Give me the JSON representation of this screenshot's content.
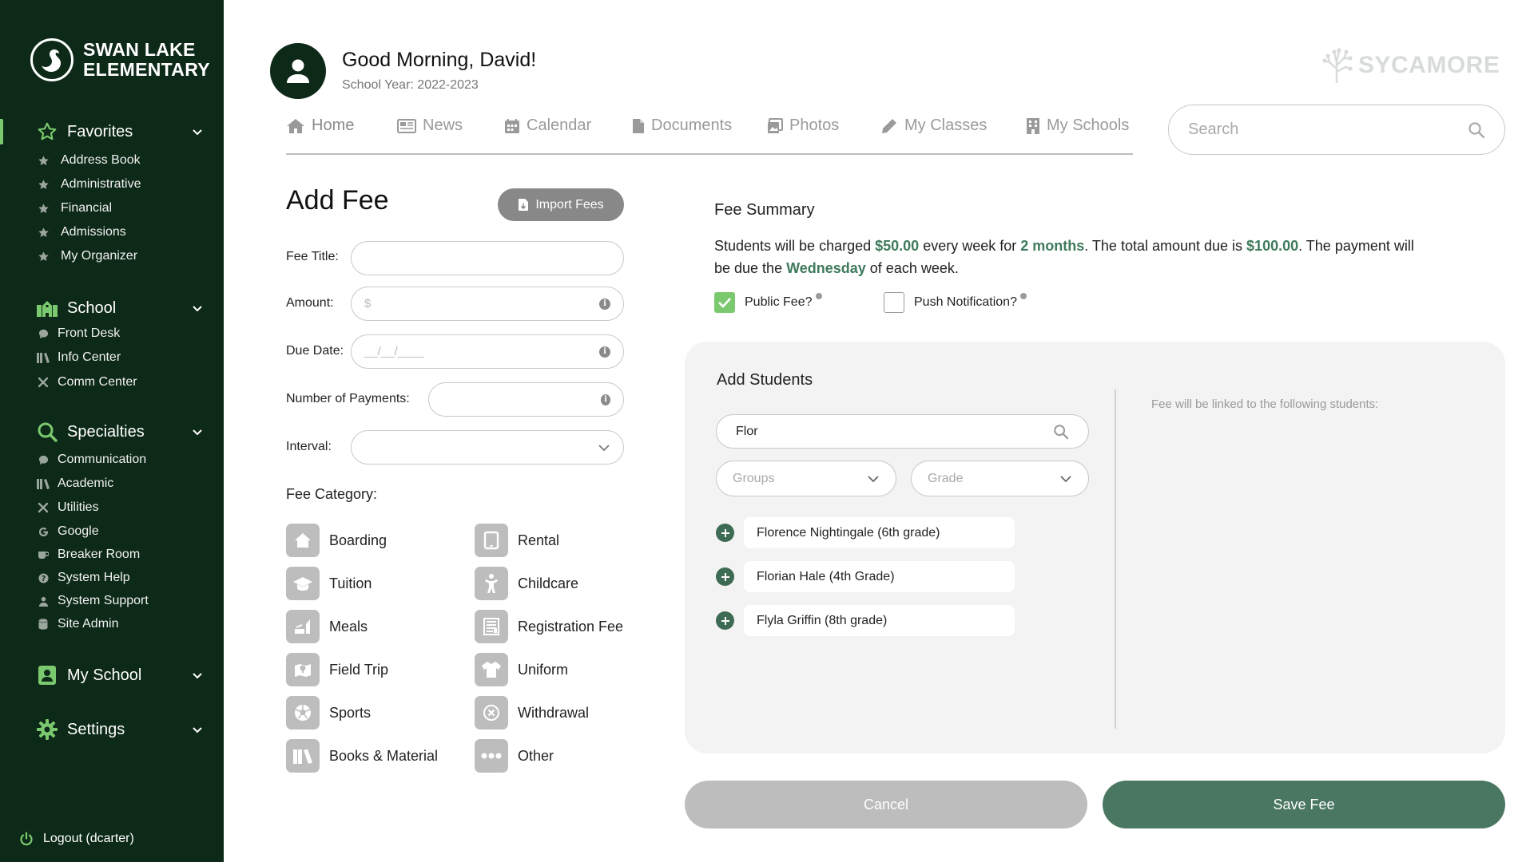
{
  "sidebar": {
    "logo_line1": "SWAN LAKE",
    "logo_line2": "ELEMENTARY",
    "favorites_label": "Favorites",
    "favorites": [
      "Address Book",
      "Administrative",
      "Financial",
      "Admissions",
      "My Organizer"
    ],
    "school_label": "School",
    "school_items": [
      "Front Desk",
      "Info Center",
      "Comm Center"
    ],
    "specialties_label": "Specialties",
    "specialties_items": [
      "Communication",
      "Academic",
      "Utilities",
      "Google",
      "Breaker Room",
      "System Help",
      "System Support",
      "Site Admin"
    ],
    "myschool_label": "My School",
    "settings_label": "Settings",
    "logout_label": "Logout (dcarter)"
  },
  "header": {
    "greeting": "Good Morning, David!",
    "school_year": "School Year: 2022-2023",
    "brand": "SYCAMORE",
    "tabs": [
      "Home",
      "News",
      "Calendar",
      "Documents",
      "Photos",
      "My Classes",
      "My Schools"
    ],
    "search_placeholder": "Search"
  },
  "form": {
    "title": "Add Fee",
    "import_label": "Import Fees",
    "fee_title_label": "Fee Title:",
    "fee_title_value": "",
    "amount_label": "Amount:",
    "amount_placeholder": "$",
    "due_date_label": "Due Date:",
    "due_date_placeholder": "__/__/____",
    "payments_label": "Number of Payments:",
    "payments_value": "",
    "interval_label": "Interval:",
    "interval_value": "",
    "category_title": "Fee Category:",
    "categories": [
      "Boarding",
      "Rental",
      "Tuition",
      "Childcare",
      "Meals",
      "Registration Fee",
      "Field Trip",
      "Uniform",
      "Sports",
      "Withdrawal",
      "Books & Material",
      "Other"
    ]
  },
  "summary": {
    "title": "Fee Summary",
    "t1": "Students will be charged ",
    "amount": "$50.00",
    "t2": " every week for ",
    "duration": "2 months",
    "t3": ". The total amount due is ",
    "total": "$100.00",
    "t4": ". The payment will be due the ",
    "day": "Wednesday",
    "t5": " of each week.",
    "public_label": "Public Fee?",
    "public_checked": true,
    "push_label": "Push Notification?",
    "push_checked": false
  },
  "students": {
    "title": "Add Students",
    "search_value": "Flor",
    "groups_placeholder": "Groups",
    "grade_placeholder": "Grade",
    "linked_text": "Fee will be linked to the following students:",
    "results": [
      "Florence Nightingale (6th grade)",
      "Florian Hale (4th Grade)",
      "Flyla Griffin (8th grade)"
    ]
  },
  "actions": {
    "cancel": "Cancel",
    "save": "Save Fee"
  },
  "colors": {
    "sidebar_bg": "#0d2918",
    "accent_green": "#7bc96f",
    "highlight": "#3e7a5c",
    "save_button": "#4a7762"
  }
}
